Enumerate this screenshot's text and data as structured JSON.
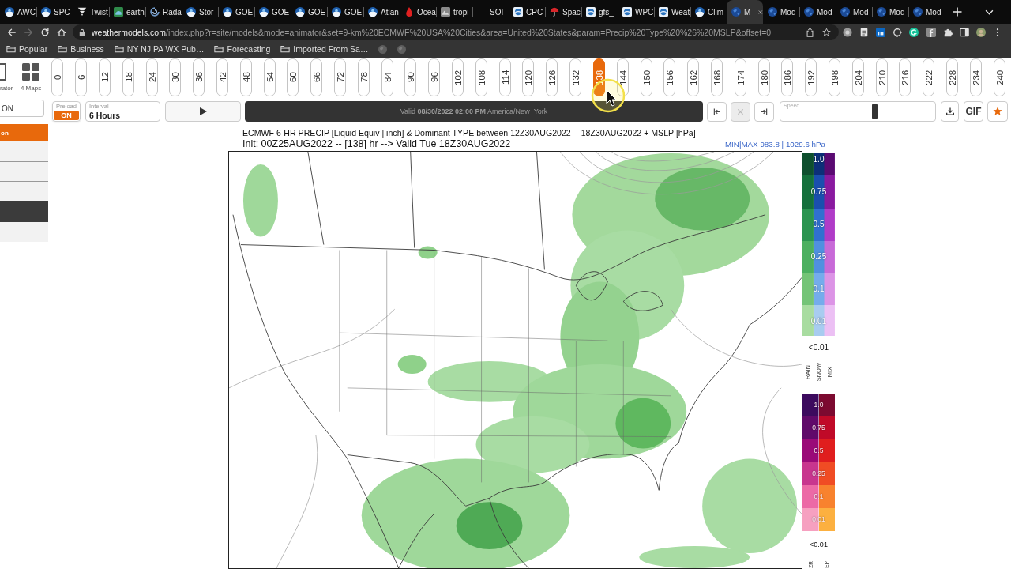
{
  "browser": {
    "tabs": [
      {
        "title": "AWC",
        "selected": false
      },
      {
        "title": "SPC",
        "selected": false
      },
      {
        "title": "Twist",
        "selected": false
      },
      {
        "title": "earth",
        "selected": false
      },
      {
        "title": "Rada",
        "selected": false
      },
      {
        "title": "Stor",
        "selected": false
      },
      {
        "title": "GOE",
        "selected": false
      },
      {
        "title": "GOE",
        "selected": false
      },
      {
        "title": "GOE",
        "selected": false
      },
      {
        "title": "GOE",
        "selected": false
      },
      {
        "title": "Atlan",
        "selected": false
      },
      {
        "title": "Ocea",
        "selected": false
      },
      {
        "title": "tropi",
        "selected": false
      },
      {
        "title": "SOI",
        "selected": false
      },
      {
        "title": "CPC",
        "selected": false
      },
      {
        "title": "Spac",
        "selected": false
      },
      {
        "title": "gfs_",
        "selected": false
      },
      {
        "title": "WPC",
        "selected": false
      },
      {
        "title": "Weat",
        "selected": false
      },
      {
        "title": "Clim",
        "selected": false
      },
      {
        "title": "M",
        "selected": true
      },
      {
        "title": "Mod",
        "selected": false
      },
      {
        "title": "Mod",
        "selected": false
      },
      {
        "title": "Mod",
        "selected": false
      },
      {
        "title": "Mod",
        "selected": false
      },
      {
        "title": "Mod",
        "selected": false
      }
    ],
    "nav": [
      {
        "kind": "back",
        "disabled": false
      },
      {
        "kind": "forward",
        "disabled": true
      },
      {
        "kind": "reload",
        "disabled": false
      },
      {
        "kind": "home",
        "disabled": false
      }
    ],
    "address": {
      "host": "weathermodels.com",
      "path": "/index.php?r=site/models&mode=animator&set=9-km%20ECMWF%20USA%20Cities&area=United%20States&param=Precip%20Type%20%26%20MSLP&offset=0"
    },
    "bookmarks": [
      "Popular",
      "Business",
      "NY NJ PA WX Pub…",
      "Forecasting",
      "Imported From Sa…"
    ]
  },
  "toolbar": {
    "views": [
      {
        "kind": "single",
        "label": "rator"
      },
      {
        "kind": "grid",
        "label": "4 Maps"
      }
    ],
    "hours": [
      {
        "label": "0",
        "selected": false
      },
      {
        "label": "6",
        "selected": false
      },
      {
        "label": "12",
        "selected": false
      },
      {
        "label": "18",
        "selected": false
      },
      {
        "label": "24",
        "selected": false
      },
      {
        "label": "30",
        "selected": false
      },
      {
        "label": "36",
        "selected": false
      },
      {
        "label": "42",
        "selected": false
      },
      {
        "label": "48",
        "selected": false
      },
      {
        "label": "54",
        "selected": false
      },
      {
        "label": "60",
        "selected": false
      },
      {
        "label": "66",
        "selected": false
      },
      {
        "label": "72",
        "selected": false
      },
      {
        "label": "78",
        "selected": false
      },
      {
        "label": "84",
        "selected": false
      },
      {
        "label": "90",
        "selected": false
      },
      {
        "label": "96",
        "selected": false
      },
      {
        "label": "102",
        "selected": false
      },
      {
        "label": "108",
        "selected": false
      },
      {
        "label": "114",
        "selected": false
      },
      {
        "label": "120",
        "selected": false
      },
      {
        "label": "126",
        "selected": false
      },
      {
        "label": "132",
        "selected": false
      },
      {
        "label": "138",
        "selected": true
      },
      {
        "label": "144",
        "selected": false
      },
      {
        "label": "150",
        "selected": false
      },
      {
        "label": "156",
        "selected": false
      },
      {
        "label": "162",
        "selected": false
      },
      {
        "label": "168",
        "selected": false
      },
      {
        "label": "174",
        "selected": false
      },
      {
        "label": "180",
        "selected": false
      },
      {
        "label": "186",
        "selected": false
      },
      {
        "label": "192",
        "selected": false
      },
      {
        "label": "198",
        "selected": false
      },
      {
        "label": "204",
        "selected": false
      },
      {
        "label": "210",
        "selected": false
      },
      {
        "label": "216",
        "selected": false
      },
      {
        "label": "222",
        "selected": false
      },
      {
        "label": "228",
        "selected": false
      },
      {
        "label": "234",
        "selected": false
      },
      {
        "label": "240",
        "selected": false
      }
    ]
  },
  "controls": {
    "toggle": "ON",
    "preload": {
      "label": "Preload",
      "value": "ON",
      "on": true
    },
    "interval": {
      "label": "Interval",
      "value": "6 Hours"
    },
    "valid": "Valid **08/30/2022 02:00 PM** America/New_York",
    "frame_buttons": [
      {
        "kind": "first",
        "disabled": false
      },
      {
        "kind": "clear",
        "disabled": true
      },
      {
        "kind": "last",
        "disabled": false
      }
    ],
    "speed": {
      "label": "Speed",
      "level": 0.61
    },
    "gif": "GIF"
  },
  "sidebar": {
    "items": [
      {
        "kind": "option",
        "label": "on",
        "selected": true
      },
      {
        "kind": "option",
        "selected": false
      },
      {
        "kind": "option",
        "selected": false
      },
      {
        "kind": "option",
        "selected": false
      },
      {
        "kind": "header",
        "selected": false
      },
      {
        "kind": "option",
        "selected": false
      }
    ]
  },
  "map": {
    "title": "ECMWF 6-HR PRECIP [Liquid Equiv | inch] & Dominant TYPE between 12Z30AUG2022 -- 18Z30AUG2022 + MSLP [hPa]",
    "subtitle": "Init: 00Z25AUG2022 -- [138] hr --> Valid Tue 18Z30AUG2022",
    "min_max": "MIN|MAX 983.8 | 1029.6 hPa"
  },
  "legend": {
    "rain": [
      "1.0",
      "0.75",
      "0.5",
      "0.25",
      "0.1",
      "0.01"
    ],
    "rain_below": "<0.01",
    "types": [
      "RAIN",
      "SNOW",
      "MIX"
    ],
    "mix": [
      "1.0",
      "0.75",
      "0.5",
      "0.25",
      "0.1",
      "0.01"
    ],
    "mix_below": "<0.01",
    "more_types": [
      "ZR",
      "EP"
    ]
  }
}
